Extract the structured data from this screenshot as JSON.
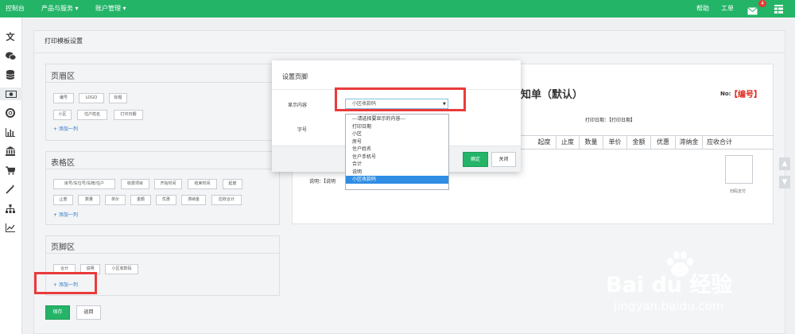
{
  "topbar": {
    "nav": [
      "控制台",
      "产品与服务 ▾",
      "账户管理 ▾"
    ],
    "help": "帮助",
    "ticket": "工单",
    "mail_count": "4"
  },
  "sidebar": {
    "icons": [
      "text-icon",
      "wechat-icon",
      "database-icon",
      "money-icon",
      "lifebuoy-icon",
      "bar-chart-icon",
      "bank-icon",
      "cart-icon",
      "magic-wand-icon",
      "sitemap-icon",
      "line-chart-icon"
    ]
  },
  "page": {
    "title": "打印模板设置"
  },
  "header_section": {
    "title": "页眉区",
    "chips": [
      "编号",
      "LOGO",
      "标题",
      "小区",
      "住户姓名",
      "打印日期"
    ],
    "add": "+ 添加一列"
  },
  "table_section": {
    "title": "表格区",
    "chips": [
      "房号/车位号/车牌/住户",
      "收费项目",
      "开始时间",
      "结束时间",
      "起度",
      "止度",
      "数量",
      "单价",
      "金额",
      "优惠",
      "滞纳金",
      "应收合计"
    ],
    "add": "+ 添加一列"
  },
  "footer_section": {
    "title": "页脚区",
    "chips": [
      "合计",
      "说明",
      "小区收款码"
    ],
    "add": "+ 添加一列"
  },
  "actions": {
    "save": "保存",
    "back": "返回"
  },
  "preview": {
    "title_fragment": "知单（默认）",
    "no_label": "No:",
    "no_value": "【编号】",
    "print_date": "打印日期：【打印日期】",
    "columns": [
      "起度",
      "止度",
      "数量",
      "单价",
      "金额",
      "优惠",
      "滞纳金",
      "应收合计"
    ],
    "note": "说明：【说明",
    "qr_caption": "扫码支付"
  },
  "modal": {
    "title": "设置页脚",
    "content_label": "显示内容",
    "selected": "小区收款码",
    "font_label": "字号",
    "options": [
      "---请选择要显示的内容---",
      "打印日期",
      "小区",
      "房号",
      "住户姓名",
      "住户手机号",
      "合计",
      "说明",
      "小区收款码"
    ],
    "confirm": "确定",
    "close": "关闭"
  },
  "watermark": {
    "brand": "Bai du 经验",
    "url": "jingyan.baidu.com"
  },
  "colors": {
    "brand_green": "#23b467",
    "highlight_red": "#e93b3b",
    "link_blue": "#2a76c9",
    "selected_blue": "#2f8de4",
    "badge_red": "#e53935"
  }
}
